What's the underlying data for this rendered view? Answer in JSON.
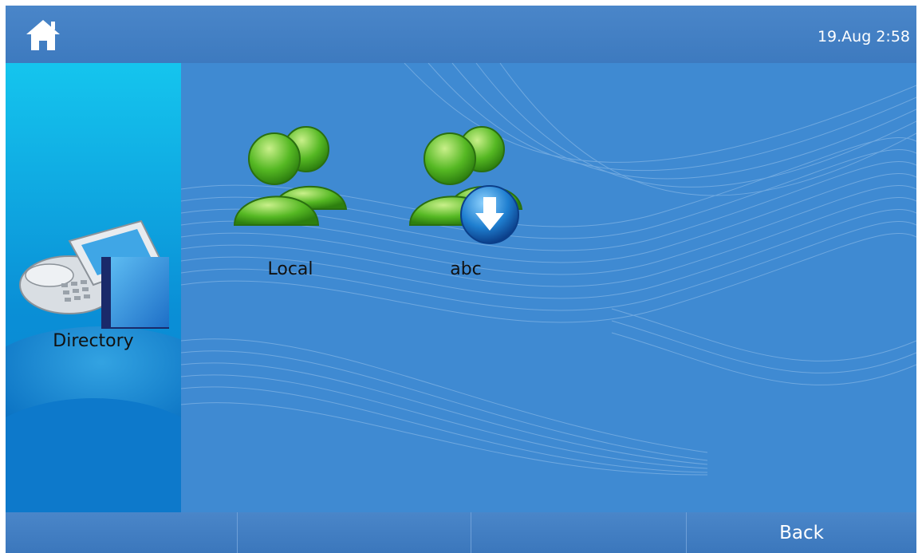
{
  "topbar": {
    "home_icon": "home-icon",
    "datetime": "19.Aug 2:58"
  },
  "left_panel": {
    "icon": "desk-phone-directory-icon",
    "label": "Directory"
  },
  "groups": [
    {
      "label": "Local",
      "icon": "contacts-group-icon"
    },
    {
      "label": "abc",
      "icon": "contacts-group-download-icon"
    }
  ],
  "softkeys": [
    "",
    "",
    "",
    "Back"
  ],
  "colors": {
    "background": "#3f8ad2",
    "bar": "#4a86c9",
    "panel": "#0a8fd6",
    "contact_green": "#4fb82a",
    "download_blue": "#1f7fd0"
  }
}
